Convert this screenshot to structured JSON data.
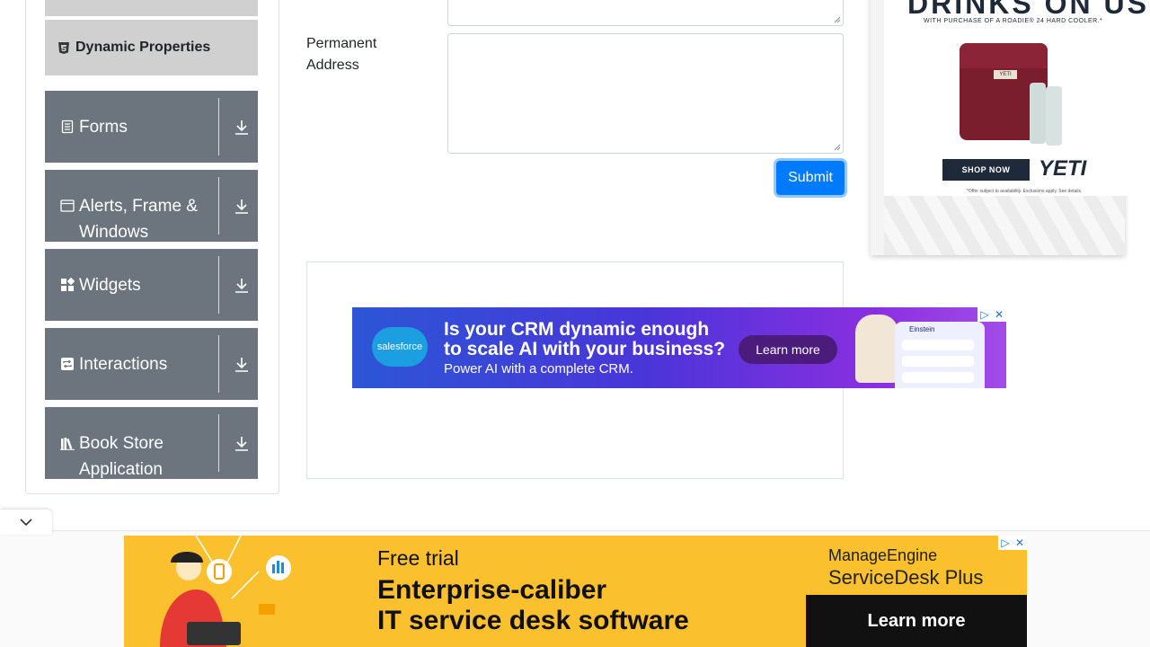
{
  "sidebar": {
    "active_item": {
      "label": "Dynamic Properties",
      "icon": "html5-icon"
    },
    "groups": [
      {
        "label": "Forms",
        "icon": "form-icon"
      },
      {
        "label": "Alerts, Frame & Windows",
        "icon": "window-icon"
      },
      {
        "label": "Widgets",
        "icon": "widgets-icon"
      },
      {
        "label": "Interactions",
        "icon": "interactions-icon"
      },
      {
        "label": "Book Store Application",
        "icon": "books-icon"
      }
    ]
  },
  "form": {
    "permanent_address_label": "Permanent Address",
    "permanent_address_value": "",
    "submit_label": "Submit"
  },
  "ads": {
    "salesforce": {
      "logo": "salesforce",
      "line1": "Is your CRM dynamic enough",
      "line2": "to scale AI with your business?",
      "line3": "Power AI with a complete CRM.",
      "button": "Learn more",
      "panel_title": "Einstein"
    },
    "yeti": {
      "headline": "DRINKS ON US",
      "subline": "WITH PURCHASE OF A ROADIE® 24 HARD COOLER.*",
      "shop_now": "SHOP NOW",
      "brand": "YETI",
      "cooler_logo": "YETI",
      "fine_print": "*Offer subject to availability. Exclusions apply. See details."
    },
    "manageengine": {
      "free_trial": "Free trial",
      "headline1": "Enterprise-caliber",
      "headline2": "IT service desk software",
      "brand1": "ManageEngine",
      "brand2": "ServiceDesk Plus",
      "button": "Learn more"
    }
  },
  "colors": {
    "sidebar_group_bg": "#6c757d",
    "sidebar_active_bg": "#d0d0d0",
    "primary": "#007bff",
    "ad_yellow": "#fbc02d"
  }
}
